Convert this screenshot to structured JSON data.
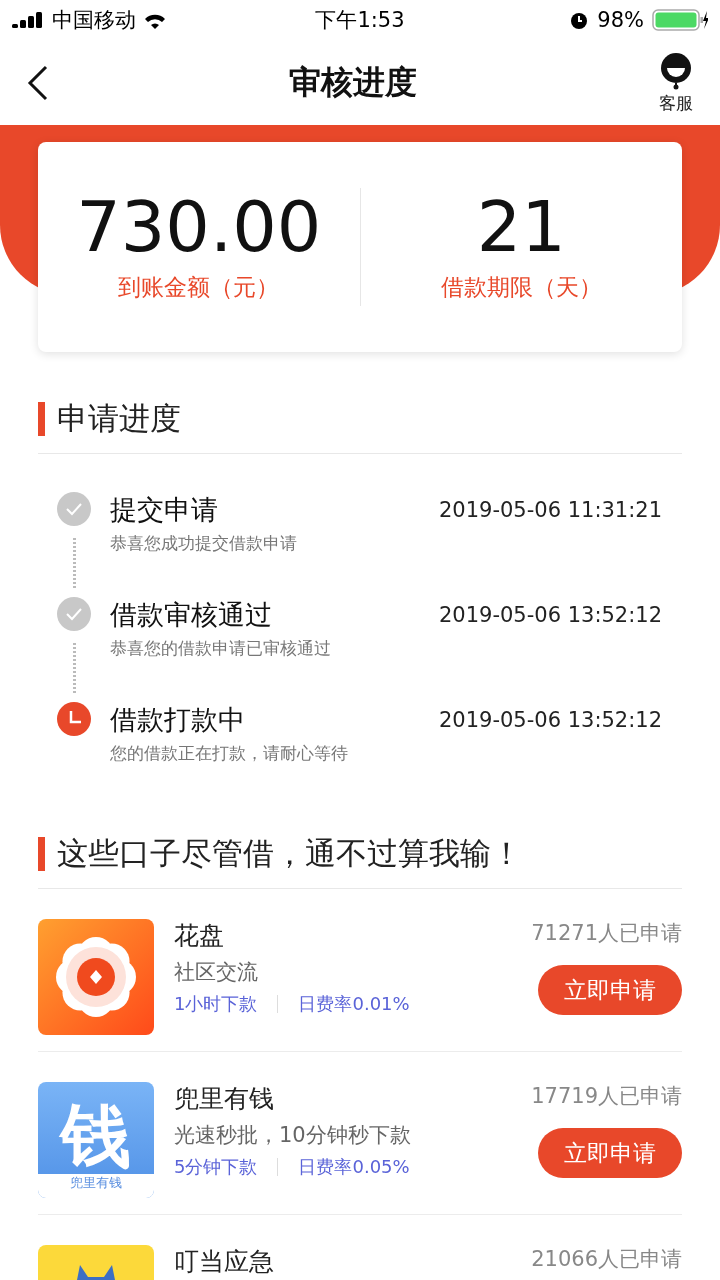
{
  "status_bar": {
    "carrier": "中国移动",
    "time": "下午1:53",
    "battery": "98%"
  },
  "header": {
    "title": "审核进度",
    "service_label": "客服"
  },
  "summary": [
    {
      "value": "730.00",
      "label": "到账金额（元）"
    },
    {
      "value": "21",
      "label": "借款期限（天）"
    }
  ],
  "progress": {
    "title": "申请进度",
    "steps": [
      {
        "kind": "done",
        "title": "提交申请",
        "time": "2019-05-06 11:31:21",
        "desc": "恭喜您成功提交借款申请"
      },
      {
        "kind": "done",
        "title": "借款审核通过",
        "time": "2019-05-06 13:52:12",
        "desc": "恭喜您的借款申请已审核通过"
      },
      {
        "kind": "current",
        "title": "借款打款中",
        "time": "2019-05-06 13:52:12",
        "desc": "您的借款正在打款，请耐心等待"
      }
    ]
  },
  "offers": {
    "title": "这些口子尽管借，通不过算我输！",
    "items": [
      {
        "kind": "flower",
        "name": "花盘",
        "desc": "社区交流",
        "tags": [
          "1小时下款",
          "日费率0.01%"
        ],
        "count": "71271人已申请",
        "button": "立即申请"
      },
      {
        "kind": "money",
        "logo_text": "钱",
        "logo_caption": "兜里有钱",
        "name": "兜里有钱",
        "desc": "光速秒批，10分钟秒下款",
        "tags": [
          "5分钟下款",
          "日费率0.05%"
        ],
        "count": "17719人已申请",
        "button": "立即申请"
      },
      {
        "kind": "figure",
        "name": "叮当应急",
        "count": "21066人已申请"
      }
    ]
  }
}
